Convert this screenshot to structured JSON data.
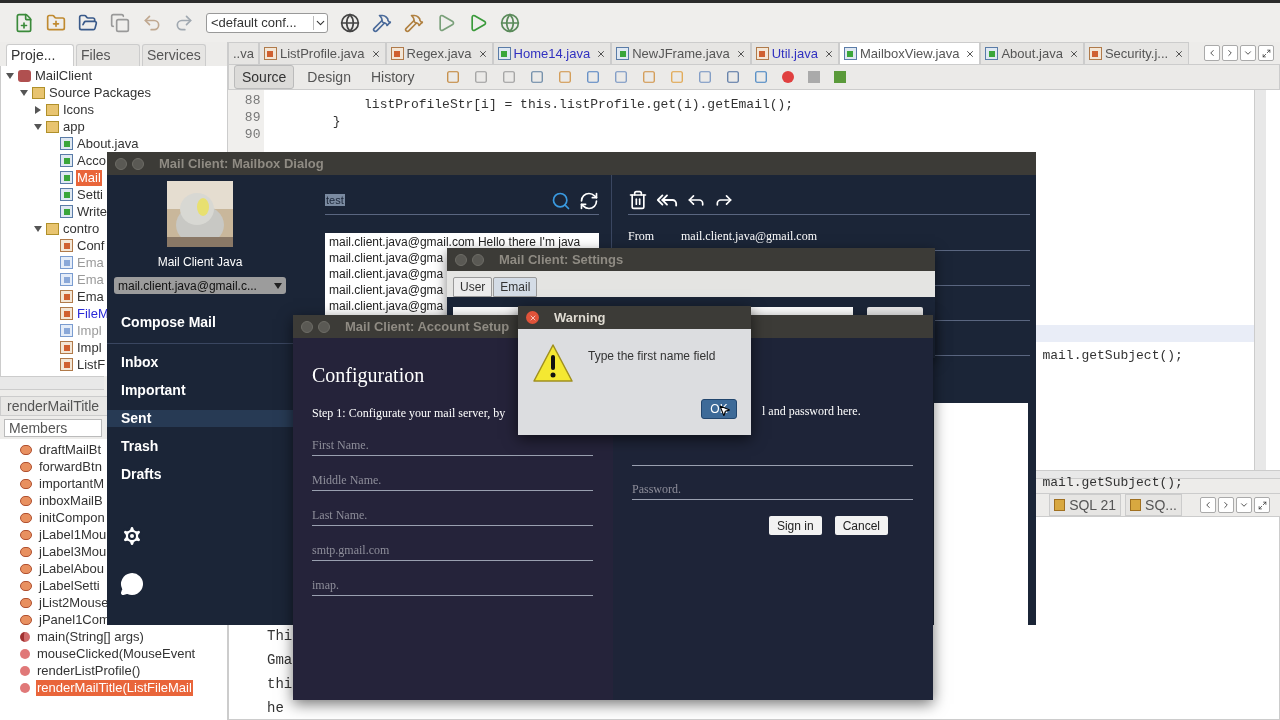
{
  "ide": {
    "toolbar": {
      "config_combo": "<default conf..."
    },
    "project_panel": {
      "tabs": [
        {
          "label": "Proje...",
          "selected": true
        },
        {
          "label": "Files",
          "selected": false
        },
        {
          "label": "Services",
          "selected": false
        }
      ],
      "tree": [
        {
          "label": "MailClient",
          "kind": "project",
          "expanded": true,
          "selected": false,
          "children": [
            {
              "label": "Source Packages",
              "kind": "source-root",
              "expanded": true,
              "selected": false,
              "children": [
                {
                  "label": "Icons",
                  "kind": "package",
                  "expanded": false,
                  "selected": false
                },
                {
                  "label": "app",
                  "kind": "package",
                  "expanded": true,
                  "selected": false,
                  "children": [
                    {
                      "label": "About.java",
                      "kind": "form",
                      "modified": false,
                      "faded": false,
                      "selected": false
                    },
                    {
                      "label": "Acco",
                      "kind": "form",
                      "modified": false,
                      "faded": false,
                      "selected": false
                    },
                    {
                      "label": "Mail",
                      "kind": "form",
                      "modified": false,
                      "faded": false,
                      "selected": true
                    },
                    {
                      "label": "Setti",
                      "kind": "form",
                      "modified": false,
                      "faded": false,
                      "selected": false
                    },
                    {
                      "label": "Write",
                      "kind": "form",
                      "modified": false,
                      "faded": false,
                      "selected": false
                    }
                  ]
                },
                {
                  "label": "contro",
                  "kind": "package",
                  "expanded": true,
                  "selected": false,
                  "children": [
                    {
                      "label": "Conf",
                      "kind": "class",
                      "modified": false,
                      "faded": false,
                      "selected": false
                    },
                    {
                      "label": "Ema",
                      "kind": "interface",
                      "modified": false,
                      "faded": true,
                      "selected": false
                    },
                    {
                      "label": "Ema",
                      "kind": "interface",
                      "modified": false,
                      "faded": true,
                      "selected": false
                    },
                    {
                      "label": "Ema",
                      "kind": "class",
                      "modified": false,
                      "faded": false,
                      "selected": false
                    },
                    {
                      "label": "FileM",
                      "kind": "class",
                      "modified": true,
                      "faded": false,
                      "selected": false
                    },
                    {
                      "label": "Impl",
                      "kind": "interface",
                      "modified": false,
                      "faded": true,
                      "selected": false
                    },
                    {
                      "label": "Impl",
                      "kind": "class",
                      "modified": false,
                      "faded": false,
                      "selected": false
                    },
                    {
                      "label": "ListF",
                      "kind": "class",
                      "modified": false,
                      "faded": false,
                      "selected": false
                    }
                  ]
                }
              ]
            }
          ]
        }
      ]
    },
    "navigator": {
      "title": "renderMailTitle",
      "filter": "Members",
      "items": [
        {
          "label": "draftMailBt",
          "kind": "field",
          "selected": false
        },
        {
          "label": "forwardBtn",
          "kind": "field",
          "selected": false
        },
        {
          "label": "importantM",
          "kind": "field",
          "selected": false
        },
        {
          "label": "inboxMailB",
          "kind": "field",
          "selected": false
        },
        {
          "label": "initCompon",
          "kind": "field",
          "selected": false
        },
        {
          "label": "jLabel1Mou",
          "kind": "field",
          "selected": false
        },
        {
          "label": "jLabel3Mou",
          "kind": "field",
          "selected": false
        },
        {
          "label": "jLabelAbou",
          "kind": "field",
          "selected": false
        },
        {
          "label": "jLabelSetti",
          "kind": "field",
          "selected": false
        },
        {
          "label": "jList2Mouse",
          "kind": "field",
          "selected": false
        },
        {
          "label": "jPanel1Com",
          "kind": "field",
          "selected": false
        },
        {
          "label": "main(String[] args)",
          "kind": "static",
          "selected": false
        },
        {
          "label": "mouseClicked(MouseEvent",
          "kind": "method",
          "selected": false
        },
        {
          "label": "renderListProfile()",
          "kind": "method",
          "selected": false
        },
        {
          "label": "renderMailTitle(ListFileMail",
          "kind": "method",
          "selected": true
        }
      ]
    },
    "editor": {
      "tabs": [
        {
          "label": "..va",
          "kind": "none",
          "modified": false,
          "selected": false
        },
        {
          "label": "ListProfile.java",
          "kind": "class",
          "modified": false,
          "selected": false
        },
        {
          "label": "Regex.java",
          "kind": "class",
          "modified": false,
          "selected": false
        },
        {
          "label": "Home14.java",
          "kind": "form",
          "modified": true,
          "selected": false
        },
        {
          "label": "NewJFrame.java",
          "kind": "form",
          "modified": false,
          "selected": false
        },
        {
          "label": "Util.java",
          "kind": "class",
          "modified": true,
          "selected": false
        },
        {
          "label": "MailboxView.java",
          "kind": "form",
          "modified": false,
          "selected": true
        },
        {
          "label": "About.java",
          "kind": "form",
          "modified": false,
          "selected": false
        },
        {
          "label": "Security.j...",
          "kind": "class",
          "modified": false,
          "selected": false
        }
      ],
      "views": [
        {
          "label": "Source",
          "selected": true
        },
        {
          "label": "Design",
          "selected": false
        },
        {
          "label": "History",
          "selected": false
        }
      ],
      "lines": [
        {
          "number": "88",
          "text": "            listProfileStr[i] = this.listProfile.get(i).getEmail();"
        },
        {
          "number": "89",
          "text": "        }"
        },
        {
          "number": "90"
        }
      ],
      "right_fragments": [
        "mail.getSubject();",
        "mail.getSubject();"
      ]
    },
    "output": {
      "tabs": [
        "SQL 21",
        "SQ..."
      ],
      "fragments": [
        "Thi",
        "Gma",
        "thi",
        "he"
      ]
    }
  },
  "mailbox_dialog": {
    "title": "Mail Client: Mailbox Dialog",
    "user_name": "Mail Client Java",
    "account": "mail.client.java@gmail.c...",
    "compose": "Compose Mail",
    "nav": [
      {
        "label": "Inbox",
        "selected": false
      },
      {
        "label": "Important",
        "selected": false
      },
      {
        "label": "Sent",
        "selected": true
      },
      {
        "label": "Trash",
        "selected": false
      },
      {
        "label": "Drafts",
        "selected": false
      }
    ],
    "search": {
      "value": "test",
      "highlighted": true
    },
    "messages": [
      "mail.client.java@gmail.com Hello there I'm java",
      "mail.client.java@gma",
      "mail.client.java@gma",
      "mail.client.java@gma",
      "mail.client.java@gma"
    ],
    "from_label": "From",
    "from_value": "mail.client.java@gmail.com"
  },
  "settings_dialog": {
    "title": "Mail Client: Settings",
    "tabs": [
      {
        "label": "User",
        "selected": false
      },
      {
        "label": "Email",
        "selected": true
      }
    ]
  },
  "account_dialog": {
    "title": "Mail Client: Account Setup",
    "heading": "Configuration",
    "step_left": "Step 1: Configurate your mail server, by",
    "step_right": "l and password here.",
    "fields": [
      {
        "placeholder": "First Name."
      },
      {
        "placeholder": "Middle Name."
      },
      {
        "placeholder": "Last Name."
      },
      {
        "placeholder": "smtp.gmail.com"
      },
      {
        "placeholder": "imap."
      }
    ],
    "password": {
      "placeholder": "Password."
    },
    "buttons": [
      "Sign in",
      "Cancel"
    ]
  },
  "warning_dialog": {
    "title": "Warning",
    "message": "Type the first name field",
    "button": "OK"
  }
}
